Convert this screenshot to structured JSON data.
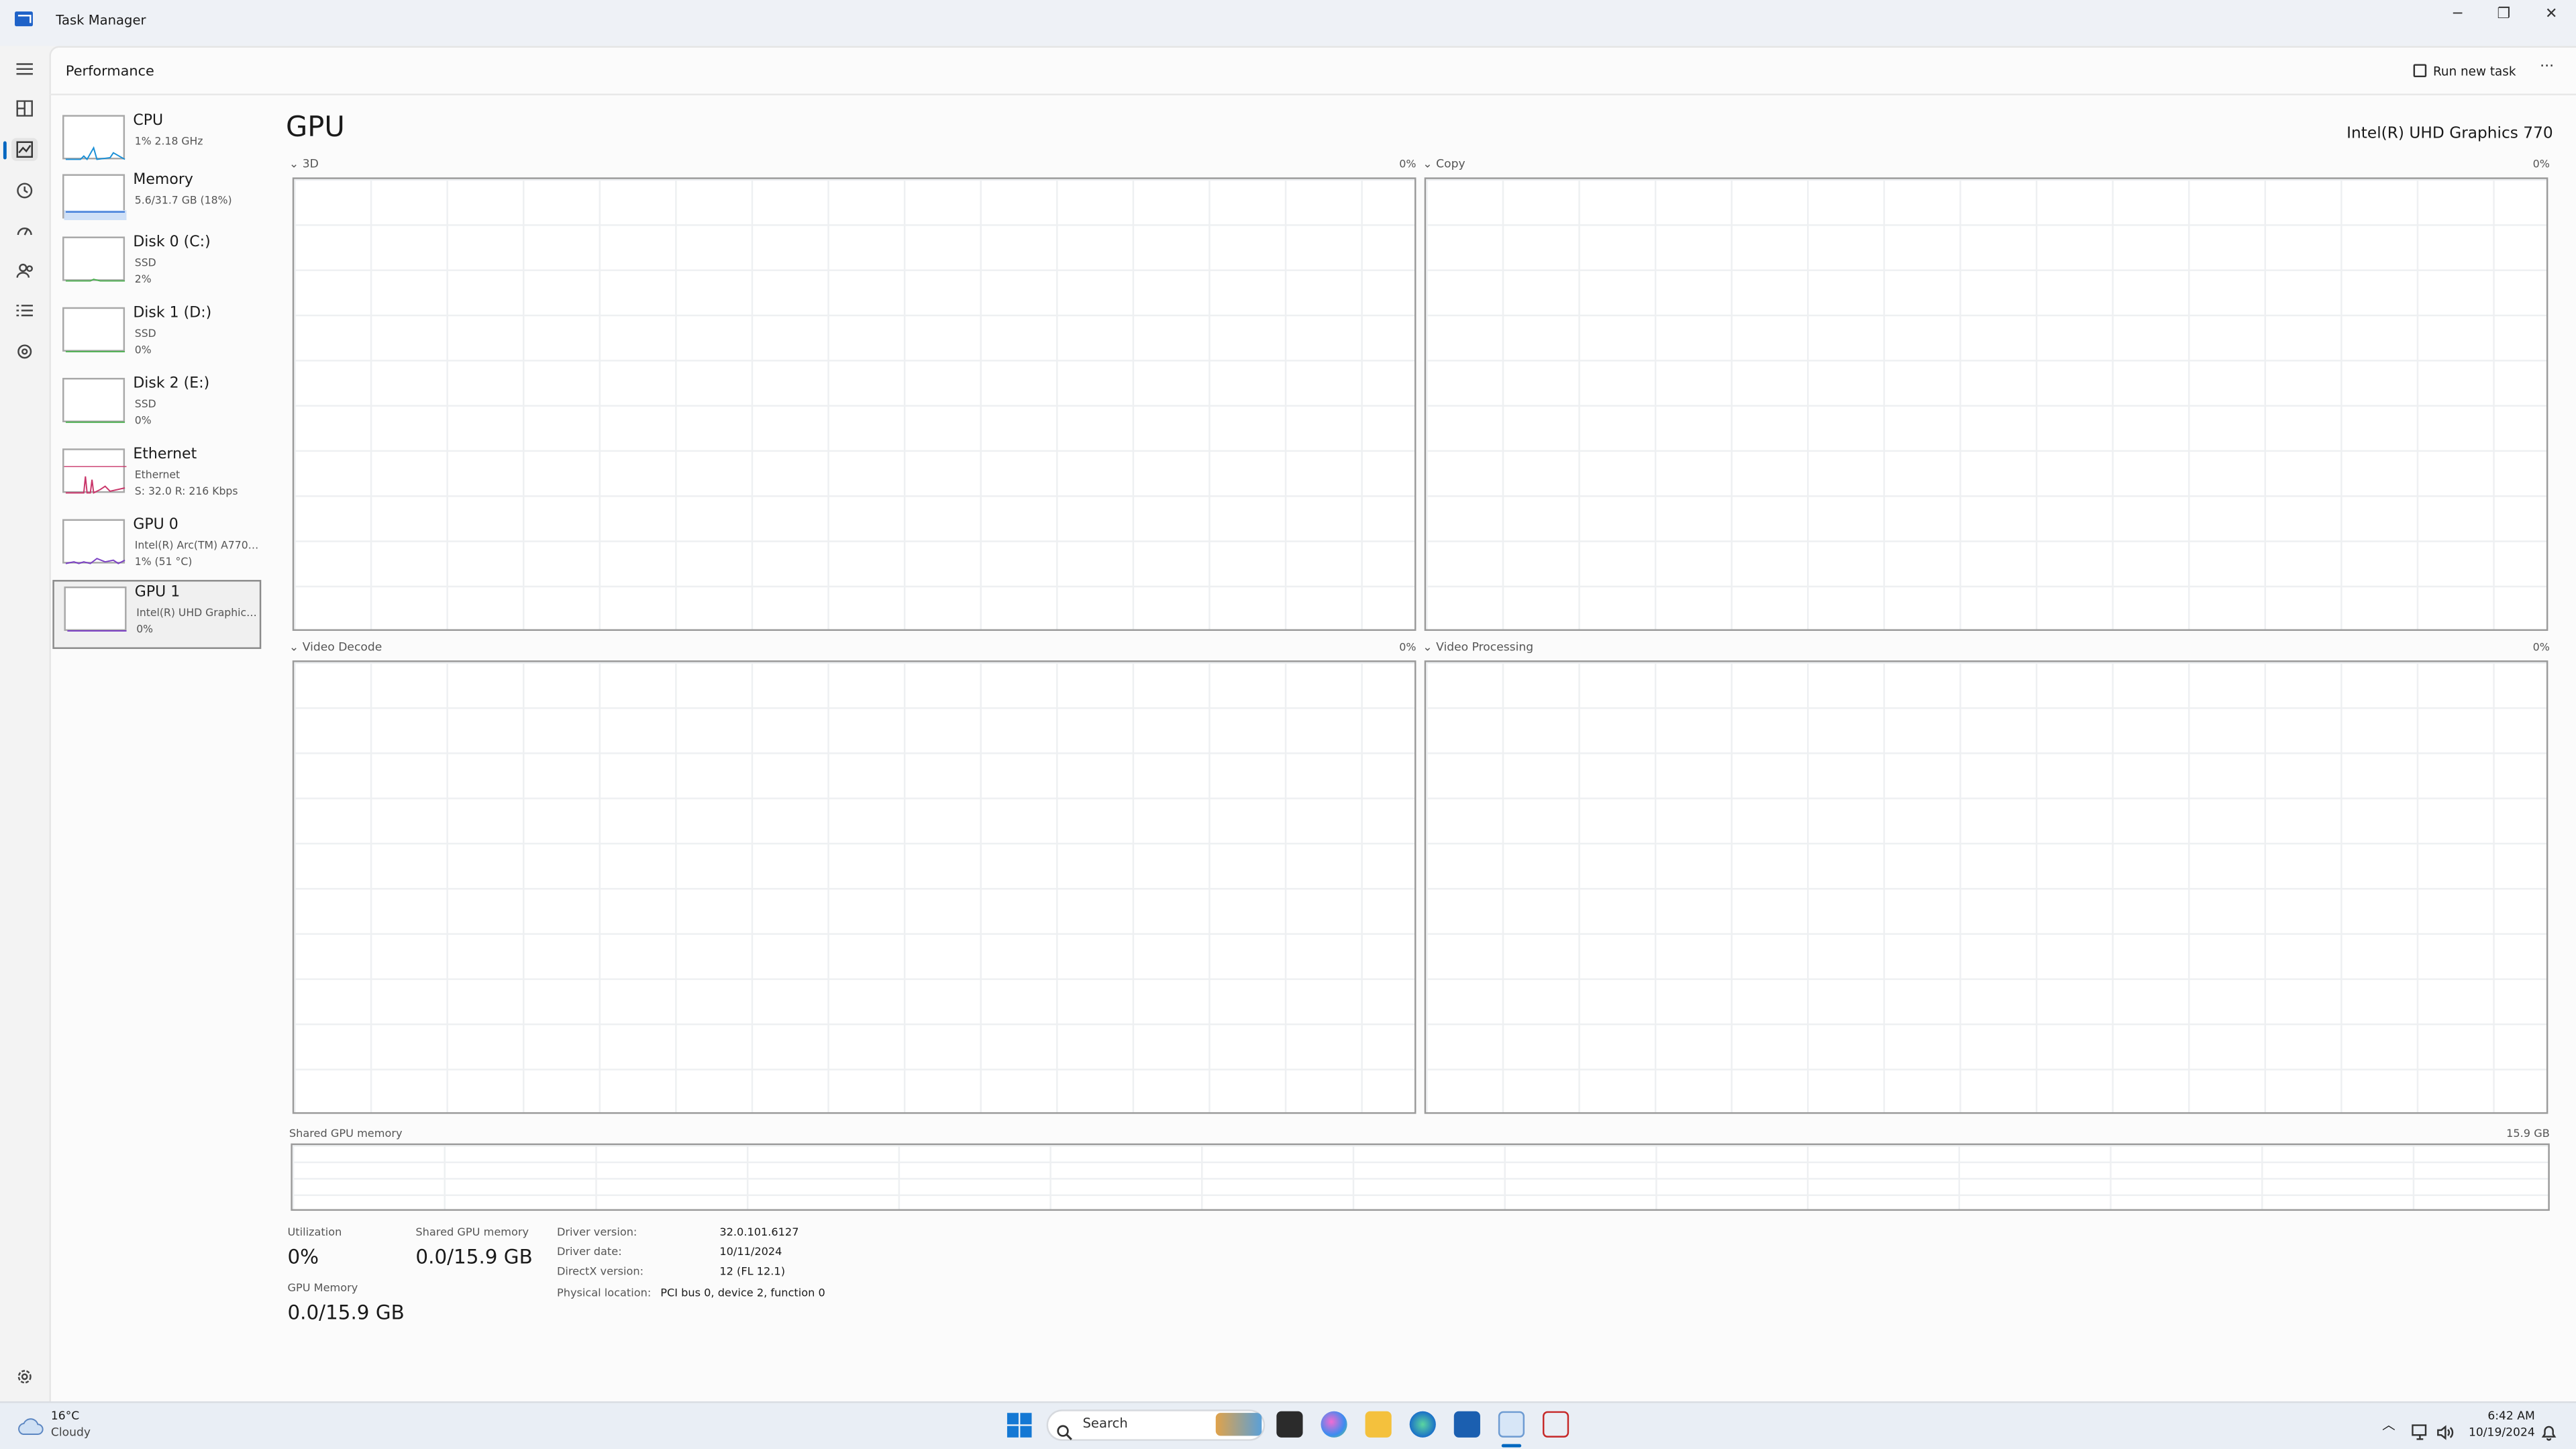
{
  "window": {
    "title": "Task Manager",
    "minimize": "─",
    "maximize": "❐",
    "close": "✕"
  },
  "header": {
    "title": "Performance",
    "run_new_task": "Run new task",
    "more": "···"
  },
  "sidebar": [
    {
      "name": "CPU",
      "line2": "1% 2.18 GHz",
      "line3": "",
      "color": "#1a8fd6"
    },
    {
      "name": "Memory",
      "line2": "5.6/31.7 GB (18%)",
      "line3": "",
      "color": "#2d6fd6"
    },
    {
      "name": "Disk 0 (C:)",
      "line2": "SSD",
      "line3": "2%",
      "color": "#4caf50"
    },
    {
      "name": "Disk 1 (D:)",
      "line2": "SSD",
      "line3": "0%",
      "color": "#4caf50"
    },
    {
      "name": "Disk 2 (E:)",
      "line2": "SSD",
      "line3": "0%",
      "color": "#4caf50"
    },
    {
      "name": "Ethernet",
      "line2": "Ethernet",
      "line3": "S: 32.0  R: 216 Kbps",
      "color": "#c9366a"
    },
    {
      "name": "GPU 0",
      "line2": "Intel(R) Arc(TM) A770 ...",
      "line3": "1% (51 °C)",
      "color": "#7b3fc4"
    },
    {
      "name": "GPU 1",
      "line2": "Intel(R) UHD Graphics ...",
      "line3": "0%",
      "color": "#7b3fc4"
    }
  ],
  "gpu": {
    "title": "GPU",
    "model": "Intel(R) UHD Graphics 770",
    "engines": [
      {
        "label": "3D",
        "percent": "0%"
      },
      {
        "label": "Copy",
        "percent": "0%"
      },
      {
        "label": "Video Decode",
        "percent": "0%"
      },
      {
        "label": "Video Processing",
        "percent": "0%"
      }
    ],
    "shared_memory_graph": {
      "label": "Shared GPU memory",
      "max": "15.9 GB"
    },
    "stats": {
      "utilization_label": "Utilization",
      "utilization": "0%",
      "shared_label": "Shared GPU memory",
      "shared": "0.0/15.9 GB",
      "gpu_memory_label": "GPU Memory",
      "gpu_memory": "0.0/15.9 GB"
    },
    "details": [
      {
        "key": "Driver version:",
        "value": "32.0.101.6127"
      },
      {
        "key": "Driver date:",
        "value": "10/11/2024"
      },
      {
        "key": "DirectX version:",
        "value": "12 (FL 12.1)"
      },
      {
        "key": "Physical location:",
        "value": "PCI bus 0, device 2, function 0"
      }
    ]
  },
  "taskbar": {
    "weather_temp": "16°C",
    "weather_desc": "Cloudy",
    "search_placeholder": "Search",
    "time": "6:42 AM",
    "date": "10/19/2024"
  },
  "icons": [
    "menu-icon",
    "processes-icon",
    "performance-icon",
    "app-history-icon",
    "startup-apps-icon",
    "users-icon",
    "details-icon",
    "services-icon",
    "settings-icon"
  ],
  "accent": "#0067c0"
}
